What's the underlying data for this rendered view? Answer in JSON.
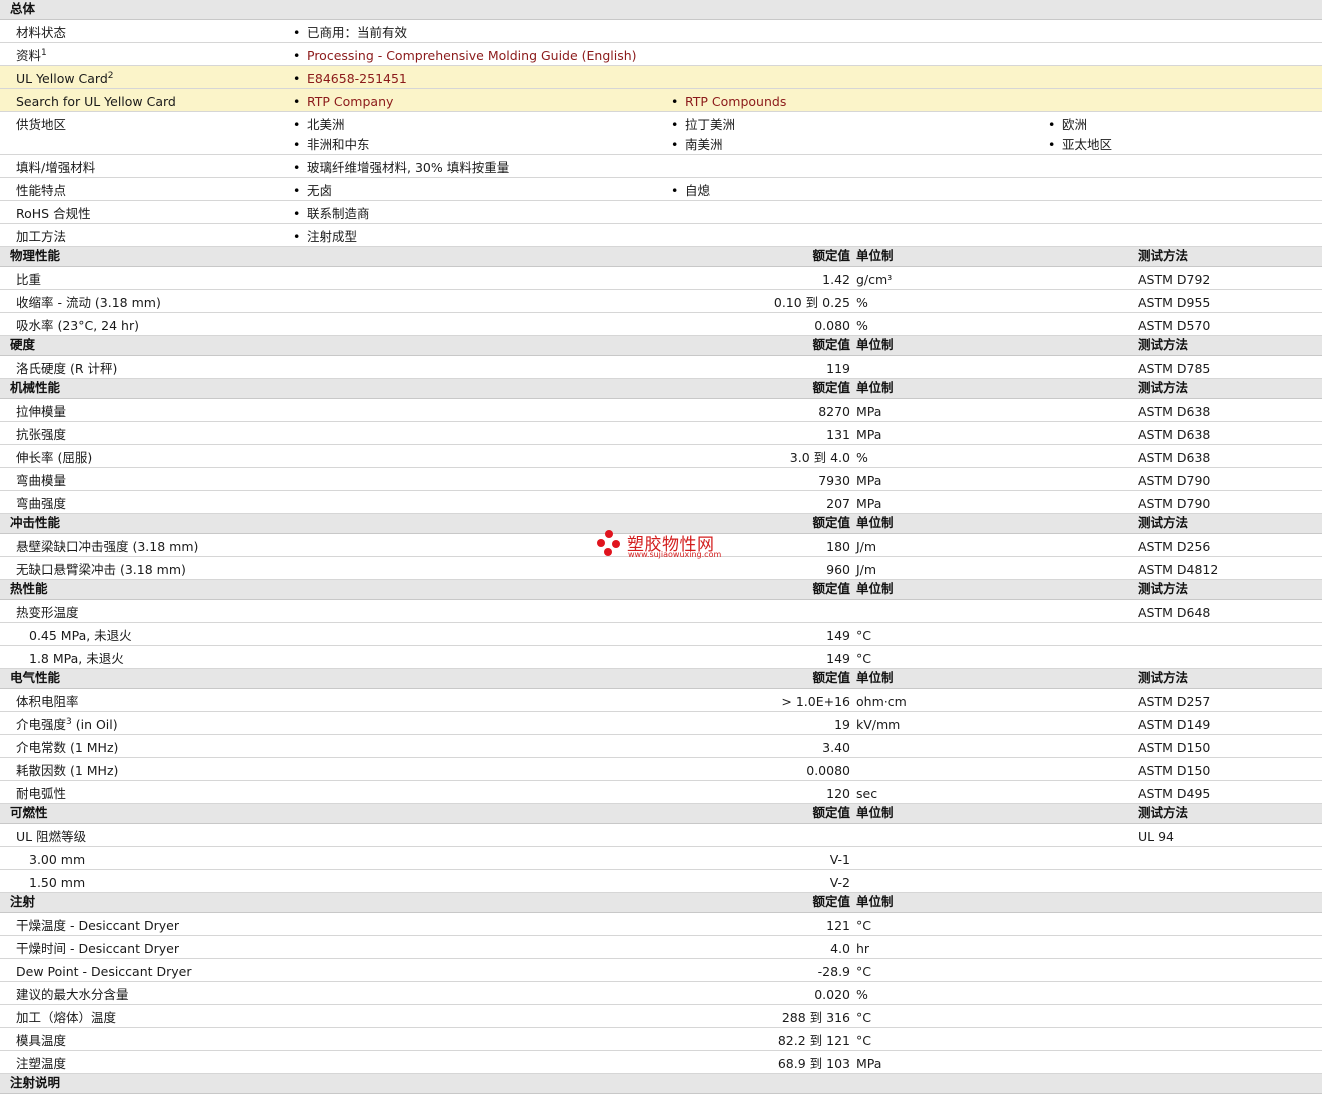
{
  "sections": [
    {
      "title": "总体",
      "show_headers": false,
      "rows": [
        {
          "kind": "general",
          "label": "材料状态",
          "items": [
            {
              "text": "已商用：当前有效"
            }
          ]
        },
        {
          "kind": "general",
          "label": "资料",
          "sup": "1",
          "items": [
            {
              "text": "Processing - Comprehensive Molding Guide (English)",
              "link": true
            }
          ]
        },
        {
          "kind": "general",
          "label": "UL Yellow Card",
          "sup": "2",
          "highlight": true,
          "items": [
            {
              "text": "E84658-251451",
              "link": true
            }
          ]
        },
        {
          "kind": "general",
          "label": "Search for UL Yellow Card",
          "highlight": true,
          "items": [
            {
              "text": "RTP Company",
              "link": true
            },
            {
              "text": "RTP Compounds",
              "link": true
            }
          ]
        },
        {
          "kind": "general",
          "label": "供货地区",
          "tall": true,
          "items": [
            {
              "text": "北美洲"
            },
            {
              "text": "拉丁美洲"
            },
            {
              "text": "欧洲"
            },
            {
              "text": "非洲和中东"
            },
            {
              "text": "南美洲"
            },
            {
              "text": "亚太地区"
            }
          ]
        },
        {
          "kind": "general",
          "label": "填料/增强材料",
          "items": [
            {
              "text": "玻璃纤维增强材料, 30% 填料按重量"
            }
          ]
        },
        {
          "kind": "general",
          "label": "性能特点",
          "items": [
            {
              "text": "无卤"
            },
            {
              "text": "自熄"
            }
          ]
        },
        {
          "kind": "general",
          "label": "RoHS 合规性",
          "items": [
            {
              "text": "联系制造商"
            }
          ]
        },
        {
          "kind": "general",
          "label": "加工方法",
          "items": [
            {
              "text": "注射成型"
            }
          ]
        }
      ]
    },
    {
      "title": "物理性能",
      "show_headers": true,
      "show_method": true,
      "rows": [
        {
          "label": "比重",
          "value": "1.42",
          "unit": "g/cm³",
          "method": "ASTM D792"
        },
        {
          "label": "收缩率 - 流动 (3.18 mm)",
          "value": "0.10 到  0.25",
          "unit": "%",
          "method": "ASTM D955"
        },
        {
          "label": "吸水率 (23°C, 24 hr)",
          "value": "0.080",
          "unit": "%",
          "method": "ASTM D570"
        }
      ]
    },
    {
      "title": "硬度",
      "show_headers": true,
      "show_method": true,
      "rows": [
        {
          "label": "洛氏硬度 (R 计秤)",
          "value": "119",
          "unit": "",
          "method": "ASTM D785"
        }
      ]
    },
    {
      "title": "机械性能",
      "show_headers": true,
      "show_method": true,
      "rows": [
        {
          "label": "拉伸模量",
          "value": "8270",
          "unit": "MPa",
          "method": "ASTM D638"
        },
        {
          "label": "抗张强度",
          "value": "131",
          "unit": "MPa",
          "method": "ASTM D638"
        },
        {
          "label": "伸长率 (屈服)",
          "value": "3.0 到  4.0",
          "unit": "%",
          "method": "ASTM D638"
        },
        {
          "label": "弯曲模量",
          "value": "7930",
          "unit": "MPa",
          "method": "ASTM D790"
        },
        {
          "label": "弯曲强度",
          "value": "207",
          "unit": "MPa",
          "method": "ASTM D790"
        }
      ]
    },
    {
      "title": "冲击性能",
      "show_headers": true,
      "show_method": true,
      "rows": [
        {
          "label": "悬壁梁缺口冲击强度 (3.18 mm)",
          "value": "180",
          "unit": "J/m",
          "method": "ASTM D256"
        },
        {
          "label": "无缺口悬臂梁冲击 (3.18 mm)",
          "value": "960",
          "unit": "J/m",
          "method": "ASTM D4812"
        }
      ]
    },
    {
      "title": "热性能",
      "show_headers": true,
      "show_method": true,
      "rows": [
        {
          "label": "热变形温度",
          "value": "",
          "unit": "",
          "method": "ASTM D648"
        },
        {
          "label": "0.45 MPa, 未退火",
          "indent": true,
          "value": "149",
          "unit": "°C",
          "method": ""
        },
        {
          "label": "1.8 MPa, 未退火",
          "indent": true,
          "value": "149",
          "unit": "°C",
          "method": ""
        }
      ]
    },
    {
      "title": "电气性能",
      "show_headers": true,
      "show_method": true,
      "rows": [
        {
          "label": "体积电阻率",
          "value": "> 1.0E+16",
          "unit": "ohm·cm",
          "method": "ASTM D257"
        },
        {
          "label": "介电强度",
          "sup": "3",
          "suffix": " (in Oil)",
          "value": "19",
          "unit": "kV/mm",
          "method": "ASTM D149"
        },
        {
          "label": "介电常数 (1 MHz)",
          "value": "3.40",
          "unit": "",
          "method": "ASTM D150"
        },
        {
          "label": "耗散因数 (1 MHz)",
          "value": "0.0080",
          "unit": "",
          "method": "ASTM D150"
        },
        {
          "label": "耐电弧性",
          "value": "120",
          "unit": "sec",
          "method": "ASTM D495"
        }
      ]
    },
    {
      "title": "可燃性",
      "show_headers": true,
      "show_method": true,
      "rows": [
        {
          "label": "UL 阻燃等级",
          "value": "",
          "unit": "",
          "method": "UL 94"
        },
        {
          "label": "3.00 mm",
          "indent": true,
          "value": "V-1",
          "unit": "",
          "method": ""
        },
        {
          "label": "1.50 mm",
          "indent": true,
          "value": "V-2",
          "unit": "",
          "method": ""
        }
      ]
    },
    {
      "title": "注射",
      "show_headers": true,
      "show_method": false,
      "rows": [
        {
          "label": "干燥温度 - Desiccant Dryer",
          "value": "121",
          "unit": "°C",
          "method": ""
        },
        {
          "label": "干燥时间 - Desiccant Dryer",
          "value": "4.0",
          "unit": "hr",
          "method": ""
        },
        {
          "label": "Dew Point - Desiccant Dryer",
          "value": "-28.9",
          "unit": "°C",
          "method": ""
        },
        {
          "label": "建议的最大水分含量",
          "value": "0.020",
          "unit": "%",
          "method": ""
        },
        {
          "label": "加工（熔体）温度",
          "value": "288 到  316",
          "unit": "°C",
          "method": ""
        },
        {
          "label": "模具温度",
          "value": "82.2 到  121",
          "unit": "°C",
          "method": ""
        },
        {
          "label": "注塑温度",
          "value": "68.9 到  103",
          "unit": "MPa",
          "method": ""
        }
      ]
    },
    {
      "title": "注射说明",
      "show_headers": false,
      "show_method": false,
      "rows": []
    }
  ],
  "headers": {
    "value": "额定值",
    "unit": "单位制",
    "method": "测试方法"
  },
  "watermark": {
    "text": "塑胶物性网",
    "url": "www.sujiaowuxing.com",
    "color": "#e0141e"
  }
}
